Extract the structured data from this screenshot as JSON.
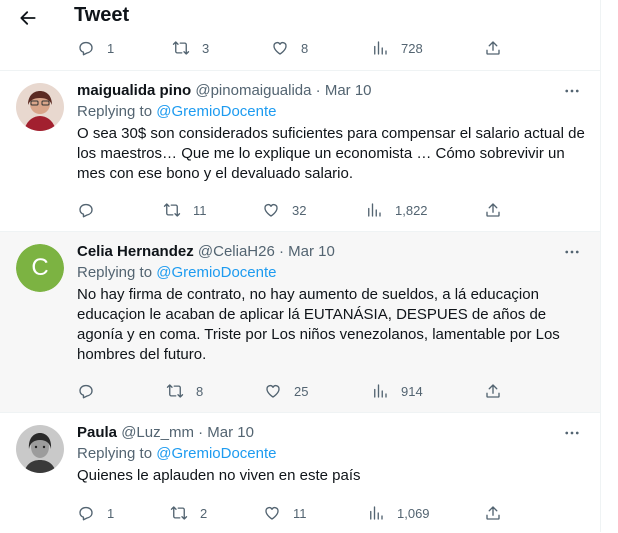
{
  "header": {
    "title": "Tweet"
  },
  "top_actions": {
    "replies": "1",
    "retweets": "3",
    "likes": "8",
    "views": "728"
  },
  "replying_label": "Replying to",
  "tweets": [
    {
      "name": "maigualida pino",
      "handle": "@pinomaigualida",
      "dot": "·",
      "date": "Mar 10",
      "mention": "@GremioDocente",
      "text": "O sea 30$ son considerados suficientes para compensar el salario actual de los maestros… Que me lo explique un economista … Cómo sobrevivir un mes con ese bono y el devaluado salario.",
      "replies": "",
      "retweets": "11",
      "likes": "32",
      "views": "1,822"
    },
    {
      "name": "Celia Hernandez",
      "handle": "@CeliaH26",
      "dot": "·",
      "date": "Mar 10",
      "mention": "@GremioDocente",
      "avatar_letter": "C",
      "avatar_color": "#7cb342",
      "text": "No hay firma de contrato, no hay  aumento de sueldos, a lá educaçion educaçion le acaban de aplicar lá EUTANÁSIA, DESPUES de años de agonía y en coma. Triste por Los niños venezolanos, lamentable por Los hombres del futuro.",
      "replies": "",
      "retweets": "8",
      "likes": "25",
      "views": "914"
    },
    {
      "name": "Paula",
      "handle": "@Luz_mm",
      "dot": "·",
      "date": "Mar 10",
      "mention": "@GremioDocente",
      "text": "Quienes le aplauden no viven en este país",
      "replies": "1",
      "retweets": "2",
      "likes": "11",
      "views": "1,069"
    }
  ],
  "icons": {
    "back": "arrow-left-icon",
    "reply": "reply-icon",
    "retweet": "retweet-icon",
    "like": "heart-icon",
    "views": "views-icon",
    "share": "share-icon",
    "more": "more-icon"
  },
  "colors": {
    "link": "#1d9bf0",
    "muted": "#536471",
    "text": "#0f1419"
  }
}
